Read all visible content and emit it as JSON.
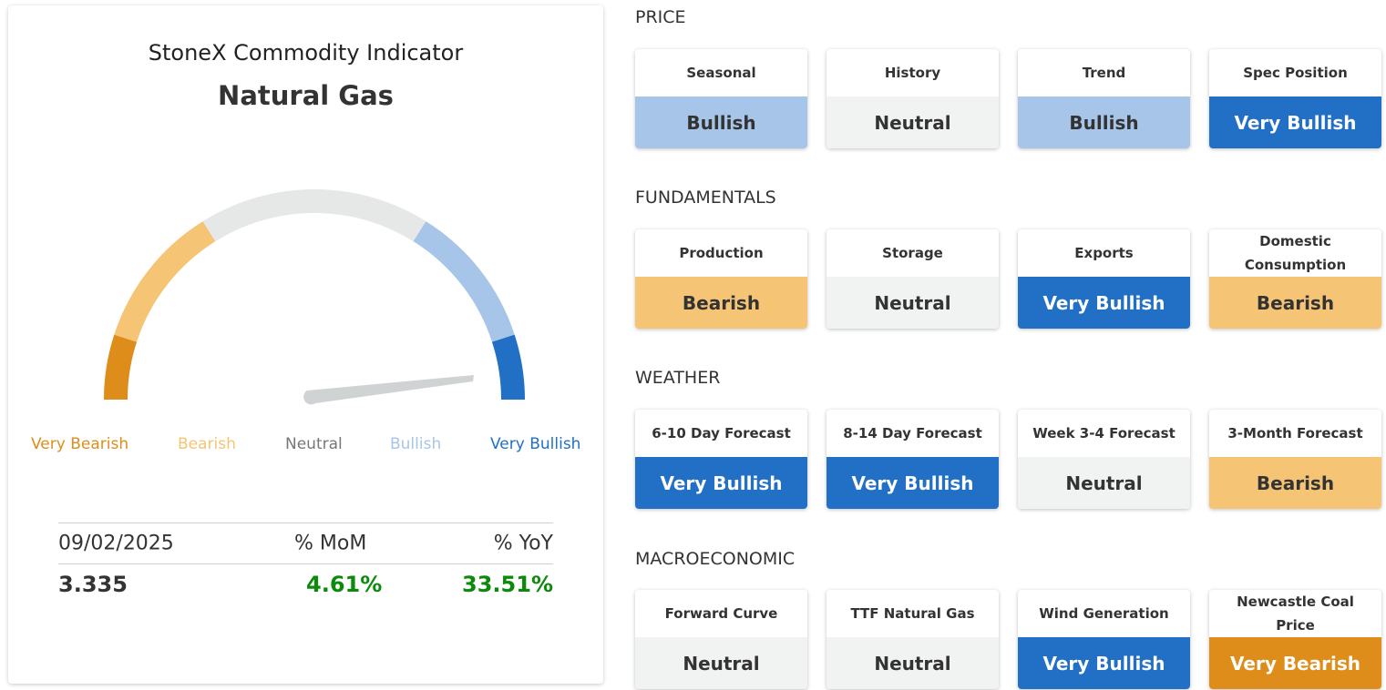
{
  "indicator": {
    "title": "StoneX Commodity Indicator",
    "commodity": "Natural Gas",
    "gauge": {
      "labels": [
        "Very Bearish",
        "Bearish",
        "Neutral",
        "Bullish",
        "Very Bullish"
      ],
      "colors": [
        "#de8d1a",
        "#f6c475",
        "#e6e7e7",
        "#a7c5e8",
        "#2270c6"
      ],
      "needle_color": "#d0d3d3"
    },
    "stats": {
      "headers": [
        "09/02/2025",
        "% MoM",
        "% YoY"
      ],
      "price": "3.335",
      "mom": "4.61%",
      "yoy": "33.51%",
      "positive_color": "#0b8a0b"
    }
  },
  "sections": [
    {
      "title": "PRICE",
      "cards": [
        {
          "label": "Seasonal",
          "value": "Bullish"
        },
        {
          "label": "History",
          "value": "Neutral"
        },
        {
          "label": "Trend",
          "value": "Bullish"
        },
        {
          "label": "Spec Position",
          "value": "Very Bullish"
        }
      ]
    },
    {
      "title": "FUNDAMENTALS",
      "cards": [
        {
          "label": "Production",
          "value": "Bearish"
        },
        {
          "label": "Storage",
          "value": "Neutral"
        },
        {
          "label": "Exports",
          "value": "Very Bullish"
        },
        {
          "label": "Domestic Consumption",
          "value": "Bearish"
        }
      ]
    },
    {
      "title": "WEATHER",
      "cards": [
        {
          "label": "6-10 Day Forecast",
          "value": "Very Bullish"
        },
        {
          "label": "8-14 Day Forecast",
          "value": "Very Bullish"
        },
        {
          "label": "Week 3-4 Forecast",
          "value": "Neutral"
        },
        {
          "label": "3-Month Forecast",
          "value": "Bearish"
        }
      ]
    },
    {
      "title": "MACROECONOMIC",
      "cards": [
        {
          "label": "Forward Curve",
          "value": "Neutral"
        },
        {
          "label": "TTF Natural Gas",
          "value": "Neutral"
        },
        {
          "label": "Wind Generation",
          "value": "Very Bullish"
        },
        {
          "label": "Newcastle Coal Price",
          "value": "Very Bearish"
        }
      ]
    }
  ]
}
